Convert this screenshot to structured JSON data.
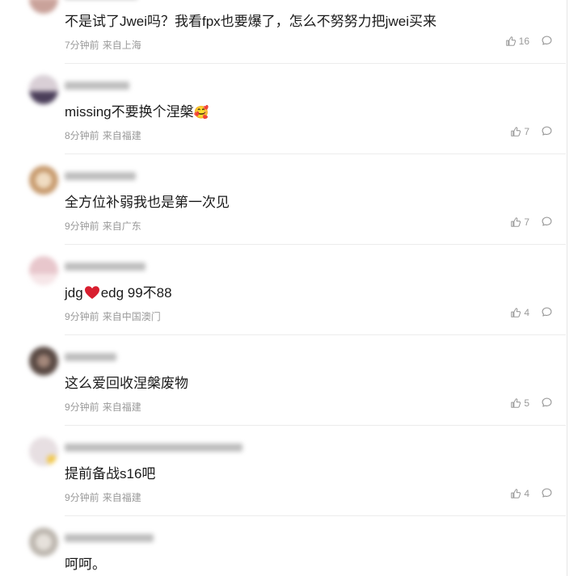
{
  "comments": [
    {
      "username": "",
      "text": "不是试了Jwei吗？我看fpx也要爆了，怎么不努努力把jwei买来",
      "time": "7分钟前",
      "location": "来自上海",
      "likes": "16",
      "avatar_color": "#c9a29a"
    },
    {
      "username": "",
      "text": "missing不要换个涅槃",
      "emoji": "🥰",
      "time": "8分钟前",
      "location": "来自福建",
      "likes": "7",
      "avatar_color": "#4b3f5a"
    },
    {
      "username": "",
      "text": "全方位补弱我也是第一次见",
      "time": "9分钟前",
      "location": "来自广东",
      "likes": "7",
      "avatar_color": "#c79a6d"
    },
    {
      "username": "",
      "text_before": "jdg",
      "text_after": "edg 99不88",
      "time": "9分钟前",
      "location": "来自中国澳门",
      "likes": "4",
      "avatar_color": "#e8c7cc"
    },
    {
      "username": "",
      "text": "这么爱回收涅槃废物",
      "time": "9分钟前",
      "location": "来自福建",
      "likes": "5",
      "avatar_color": "#5a4a44"
    },
    {
      "username": "",
      "text": "提前备战s16吧",
      "time": "9分钟前",
      "location": "来自福建",
      "likes": "4",
      "avatar_color": "#e7dfe2"
    },
    {
      "username": "",
      "text": "呵呵。",
      "time": "",
      "location": "",
      "likes": "",
      "avatar_color": "#bcb6ae"
    }
  ],
  "icons": {
    "like": "thumbs-up-icon",
    "reply": "comment-bubble-icon",
    "heart": "red-heart-emoji"
  },
  "colors": {
    "meta_text": "#9a9a9a",
    "heart": "#d81e2f"
  }
}
